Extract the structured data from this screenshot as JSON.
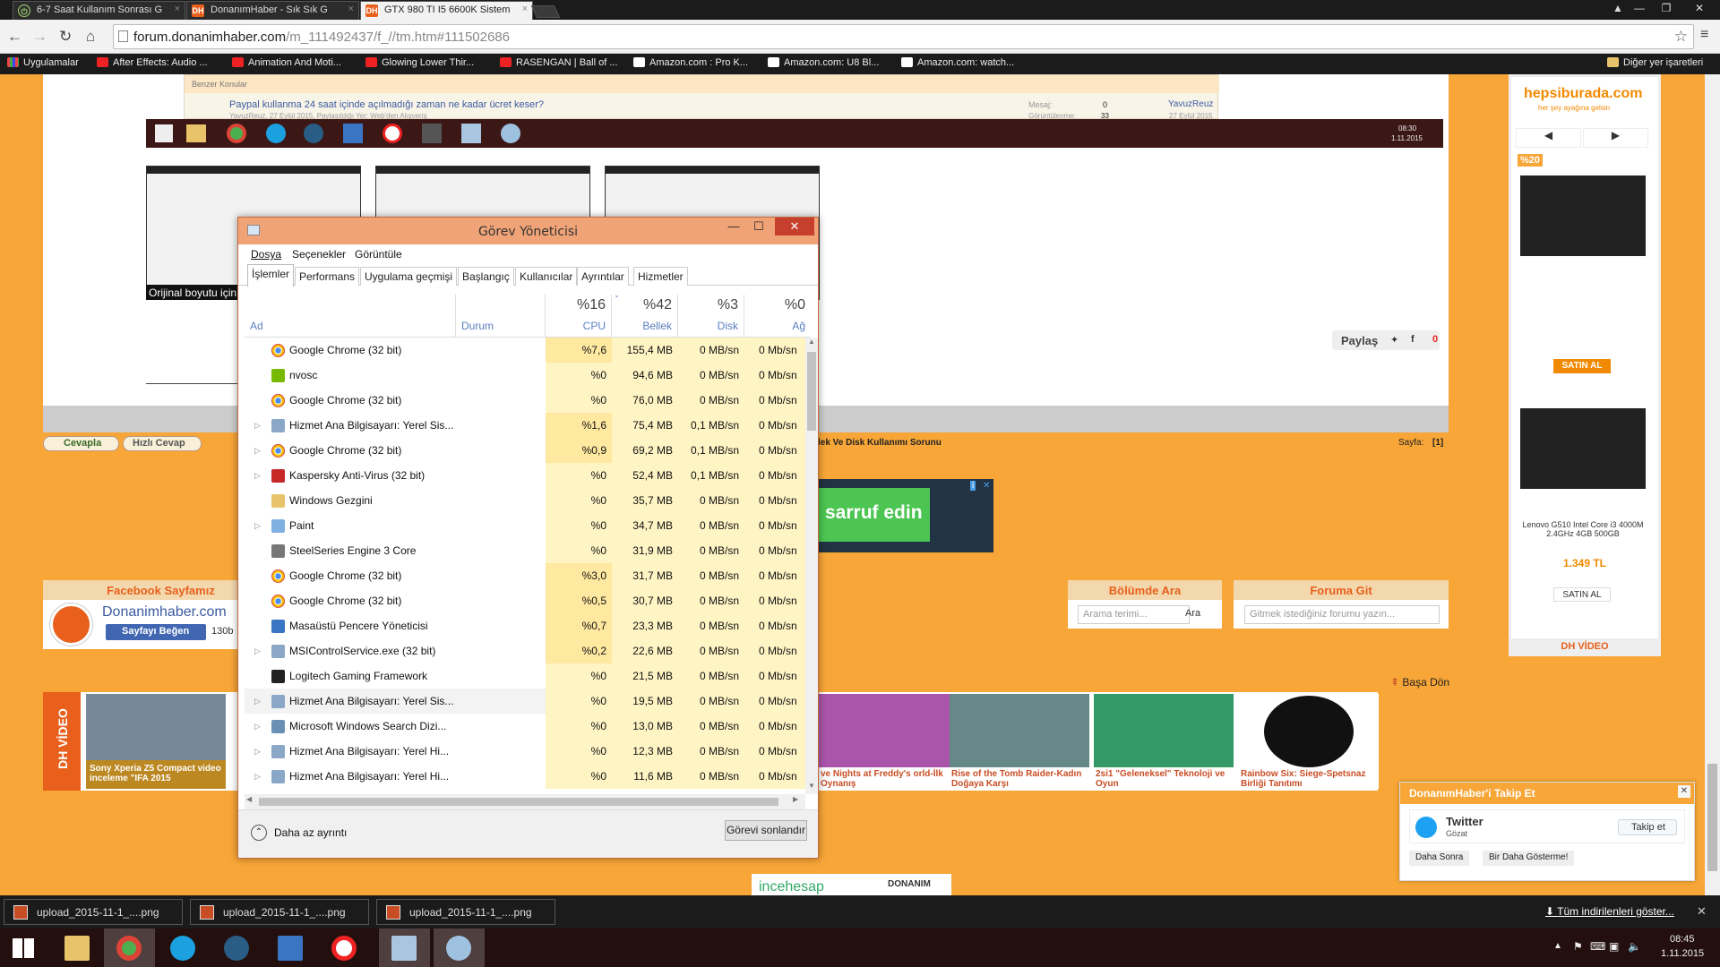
{
  "browser": {
    "tabs": [
      {
        "title": "6-7 Saat Kullanım Sonrası G",
        "icon": "power-icon"
      },
      {
        "title": "DonanımHaber - Sık Sık G",
        "icon": "dh-icon"
      },
      {
        "title": "GTX 980 TI I5 6600K Sistem",
        "icon": "dh-icon"
      }
    ],
    "url_host": "forum.donanimhaber.com",
    "url_path": "/m_111492437/f_//tm.htm#111502686",
    "bookmarks": [
      "Uygulamalar",
      "After Effects: Audio ...",
      "Animation And Moti...",
      "Glowing Lower Thir...",
      "RASENGAN | Ball of ...",
      "Amazon.com : Pro K...",
      "Amazon.com: U8 Bl...",
      "Amazon.com: watch..."
    ],
    "other_bookmarks": "Diğer yer işaretleri"
  },
  "forum": {
    "similar_topics": "Benzer Konular",
    "topic_link": "Paypal kullanma 24 saat içinde açılmadığı zaman ne kadar ücret keser?",
    "topic_meta": "YavuzReuz, 27 Eylül 2015, Paylaşıldığı Yer: Web'den Alışveriş",
    "topic_stats_label": "Mesaj:",
    "topic_stats_value": "0",
    "topic_views_label": "Görüntülenme:",
    "topic_views_value": "33",
    "topic_author": "YavuzReuz",
    "topic_date": "27 Eylül 2015",
    "embedded_time": "08:30",
    "embedded_date": "1.11.2015",
    "original_size": "Orijinal boyutu için",
    "share": "Paylaş",
    "share_count": "0",
    "reply": "Cevapla",
    "quick_reply": "Hızlı Cevap",
    "thread_title_tail": "lek Ve Disk Kullanımı Sorunu",
    "page_label": "Sayfa:",
    "page_value": "[1]",
    "ad_text": "sarruf edin",
    "facebook_title": "Facebook Sayfamız",
    "facebook_site": "Donanimhaber.com",
    "facebook_like": "Sayfayı Beğen",
    "facebook_count": "130b",
    "search_title": "Bölümde Ara",
    "search_placeholder": "Arama terimi...",
    "search_button": "Ara",
    "goto_title": "Foruma Git",
    "goto_placeholder": "Gitmek istediğiniz forumu yazın...",
    "back_to_top": "Başa Dön",
    "dh_video": "DH VİDEO",
    "videos": [
      {
        "title": "Sony Xperia Z5 Compact video inceleme \"IFA 2015"
      },
      {
        "title": "ve Nights at Freddy's orld-İlk Oynanış"
      },
      {
        "title": "Rise of the Tomb Raider-Kadın Doğaya Karşı"
      },
      {
        "title": "2si1 \"Geleneksel\" Teknoloji ve Oyun"
      },
      {
        "title": "Rainbow Six: Siege-Spetsnaz Birliği Tanıtımı"
      }
    ],
    "bottom_banner": "incehesap",
    "bottom_banner_2": "DONANIM"
  },
  "sidebar_ad": {
    "brand": "hepsiburada.com",
    "tagline": "her şey ayağına gelsin",
    "discount": "%20",
    "buy1": "SATIN AL",
    "product2": "Lenovo G510 Intel Core i3 4000M 2.4GHz 4GB 500GB",
    "price2": "1.349 TL",
    "buy2": "SATIN AL",
    "dh_video": "DH VİDEO"
  },
  "twitter_popup": {
    "title": "DonanımHaber'i Takip Et",
    "name": "Twitter",
    "sub": "Gözat",
    "follow": "Takip et",
    "later": "Daha Sonra",
    "never": "Bir Daha Gösterme!"
  },
  "task_manager": {
    "title": "Görev Yöneticisi",
    "menu": [
      "Dosya",
      "Seçenekler",
      "Görüntüle"
    ],
    "tabs": [
      "İşlemler",
      "Performans",
      "Uygulama geçmişi",
      "Başlangıç",
      "Kullanıcılar",
      "Ayrıntılar",
      "Hizmetler"
    ],
    "columns": {
      "name": "Ad",
      "status": "Durum",
      "cpu_pct": "%16",
      "cpu": "CPU",
      "mem_pct": "%42",
      "mem": "Bellek",
      "disk_pct": "%3",
      "disk": "Disk",
      "net_pct": "%0",
      "net": "Ağ"
    },
    "processes": [
      {
        "name": "Google Chrome (32 bit)",
        "cpu": "%7,6",
        "mem": "155,4 MB",
        "disk": "0 MB/sn",
        "net": "0 Mb/sn",
        "expand": false,
        "icon": "chrome-icon"
      },
      {
        "name": "nvosc",
        "cpu": "%0",
        "mem": "94,6 MB",
        "disk": "0 MB/sn",
        "net": "0 Mb/sn",
        "expand": false,
        "icon": "nvidia-icon"
      },
      {
        "name": "Google Chrome (32 bit)",
        "cpu": "%0",
        "mem": "76,0 MB",
        "disk": "0 MB/sn",
        "net": "0 Mb/sn",
        "expand": false,
        "icon": "chrome-icon"
      },
      {
        "name": "Hizmet Ana Bilgisayarı: Yerel Sis...",
        "cpu": "%1,6",
        "mem": "75,4 MB",
        "disk": "0,1 MB/sn",
        "net": "0 Mb/sn",
        "expand": true,
        "icon": "service-gear-icon"
      },
      {
        "name": "Google Chrome (32 bit)",
        "cpu": "%0,9",
        "mem": "69,2 MB",
        "disk": "0,1 MB/sn",
        "net": "0 Mb/sn",
        "expand": true,
        "icon": "chrome-icon"
      },
      {
        "name": "Kaspersky Anti-Virus (32 bit)",
        "cpu": "%0",
        "mem": "52,4 MB",
        "disk": "0,1 MB/sn",
        "net": "0 Mb/sn",
        "expand": true,
        "icon": "kaspersky-icon"
      },
      {
        "name": "Windows Gezgini",
        "cpu": "%0",
        "mem": "35,7 MB",
        "disk": "0 MB/sn",
        "net": "0 Mb/sn",
        "expand": false,
        "icon": "folder-icon"
      },
      {
        "name": "Paint",
        "cpu": "%0",
        "mem": "34,7 MB",
        "disk": "0 MB/sn",
        "net": "0 Mb/sn",
        "expand": true,
        "icon": "paint-icon"
      },
      {
        "name": "SteelSeries Engine 3 Core",
        "cpu": "%0",
        "mem": "31,9 MB",
        "disk": "0 MB/sn",
        "net": "0 Mb/sn",
        "expand": false,
        "icon": "steelseries-icon"
      },
      {
        "name": "Google Chrome (32 bit)",
        "cpu": "%3,0",
        "mem": "31,7 MB",
        "disk": "0 MB/sn",
        "net": "0 Mb/sn",
        "expand": false,
        "icon": "chrome-icon"
      },
      {
        "name": "Google Chrome (32 bit)",
        "cpu": "%0,5",
        "mem": "30,7 MB",
        "disk": "0 MB/sn",
        "net": "0 Mb/sn",
        "expand": false,
        "icon": "chrome-icon"
      },
      {
        "name": "Masaüstü Pencere Yöneticisi",
        "cpu": "%0,7",
        "mem": "23,3 MB",
        "disk": "0 MB/sn",
        "net": "0 Mb/sn",
        "expand": false,
        "icon": "window-manager-icon"
      },
      {
        "name": "MSIControlService.exe (32 bit)",
        "cpu": "%0,2",
        "mem": "22,6 MB",
        "disk": "0 MB/sn",
        "net": "0 Mb/sn",
        "expand": true,
        "icon": "service-gear-icon"
      },
      {
        "name": "Logitech Gaming Framework",
        "cpu": "%0",
        "mem": "21,5 MB",
        "disk": "0 MB/sn",
        "net": "0 Mb/sn",
        "expand": false,
        "icon": "logitech-icon"
      },
      {
        "name": "Hizmet Ana Bilgisayarı: Yerel Sis...",
        "cpu": "%0",
        "mem": "19,5 MB",
        "disk": "0 MB/sn",
        "net": "0 Mb/sn",
        "expand": true,
        "icon": "service-gear-icon"
      },
      {
        "name": "Microsoft Windows Search Dizi...",
        "cpu": "%0",
        "mem": "13,0 MB",
        "disk": "0 MB/sn",
        "net": "0 Mb/sn",
        "expand": true,
        "icon": "search-indexer-icon"
      },
      {
        "name": "Hizmet Ana Bilgisayarı: Yerel Hi...",
        "cpu": "%0",
        "mem": "12,3 MB",
        "disk": "0 MB/sn",
        "net": "0 Mb/sn",
        "expand": true,
        "icon": "service-gear-icon"
      },
      {
        "name": "Hizmet Ana Bilgisayarı: Yerel Hi...",
        "cpu": "%0",
        "mem": "11,6 MB",
        "disk": "0 MB/sn",
        "net": "0 Mb/sn",
        "expand": true,
        "icon": "service-gear-icon"
      }
    ],
    "fewer_details": "Daha az ayrıntı",
    "end_task": "Görevi sonlandır"
  },
  "downloads": {
    "items": [
      "upload_2015-11-1_....png",
      "upload_2015-11-1_....png",
      "upload_2015-11-1_....png"
    ],
    "show_all": "Tüm indirilenleri göster..."
  },
  "taskbar": {
    "time": "08:45",
    "date": "1.11.2015"
  }
}
